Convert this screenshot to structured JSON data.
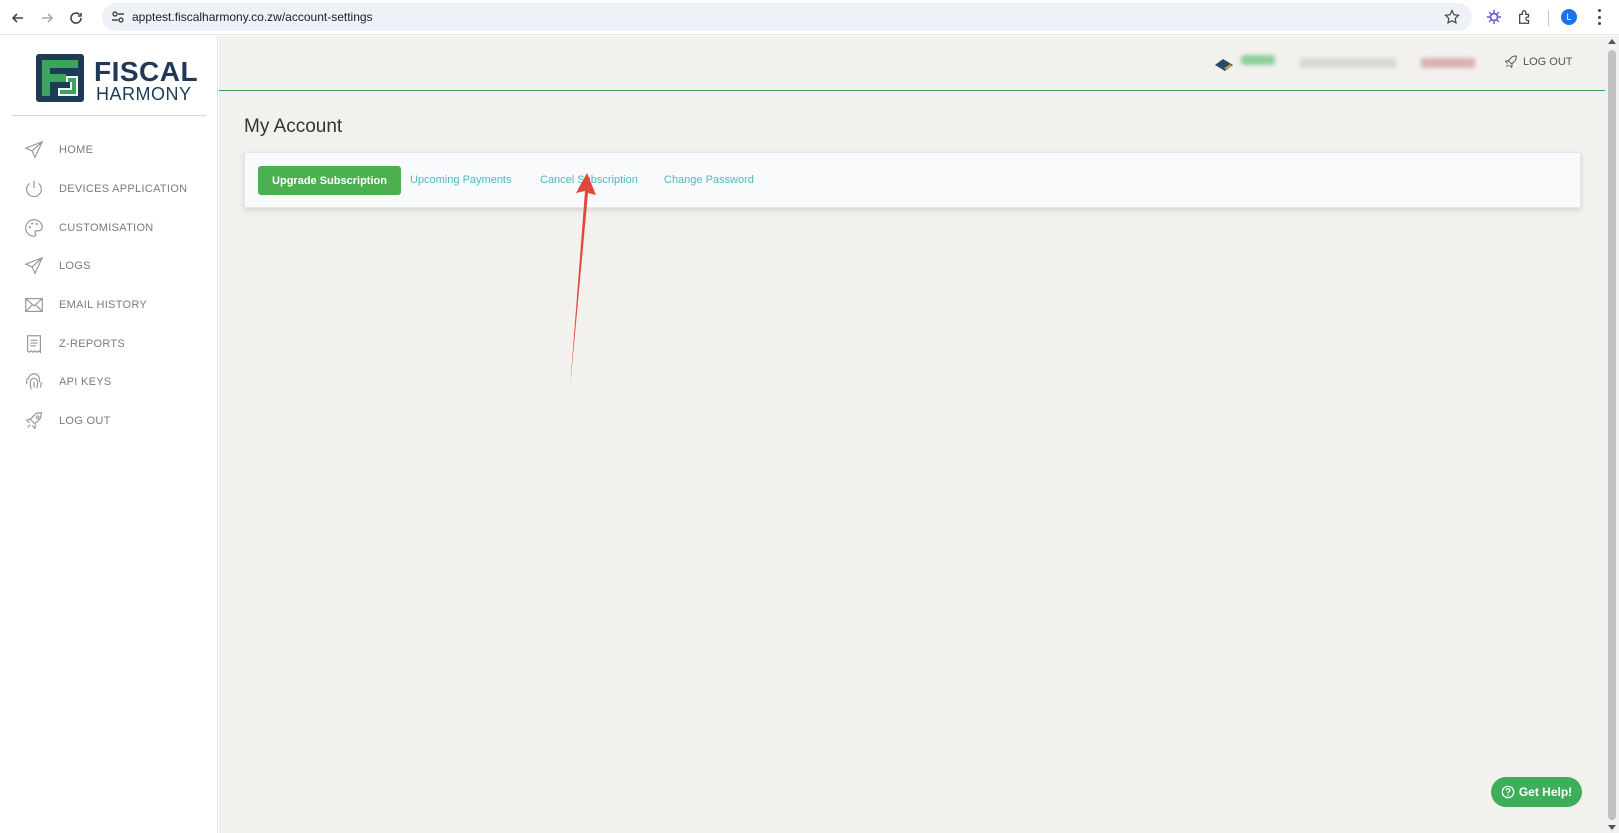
{
  "browser": {
    "url": "apptest.fiscalharmony.co.zw/account-settings",
    "profile_initial": "L"
  },
  "logo": {
    "line1": "FISCAL",
    "line2": "HARMONY"
  },
  "sidebar": {
    "items": [
      {
        "label": "HOME",
        "icon": "paper-plane-icon"
      },
      {
        "label": "DEVICES APPLICATION",
        "icon": "power-icon"
      },
      {
        "label": "CUSTOMISATION",
        "icon": "palette-icon"
      },
      {
        "label": "LOGS",
        "icon": "paper-plane-icon"
      },
      {
        "label": "EMAIL HISTORY",
        "icon": "envelope-icon"
      },
      {
        "label": "Z-REPORTS",
        "icon": "receipt-icon"
      },
      {
        "label": "API KEYS",
        "icon": "fingerprint-icon"
      },
      {
        "label": "LOG OUT",
        "icon": "rocket-icon"
      }
    ]
  },
  "topbar": {
    "logout_label": "LOG OUT"
  },
  "page": {
    "title": "My Account",
    "upgrade_label": "Upgrade Subscription",
    "tabs": [
      {
        "label": "Upcoming Payments"
      },
      {
        "label": "Cancel Subscription"
      },
      {
        "label": "Change Password"
      }
    ]
  },
  "help": {
    "label": "Get Help!"
  },
  "colors": {
    "primary_green": "#4caf50",
    "link_teal": "#4fb8c3",
    "brand_navy": "#1e3a56",
    "annotation_red": "#e0483a"
  }
}
